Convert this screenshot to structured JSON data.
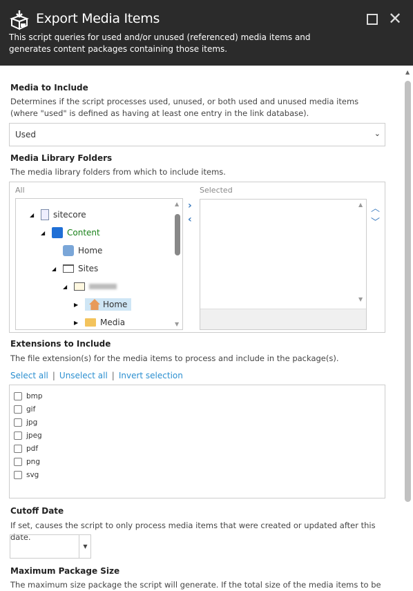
{
  "dialog": {
    "title": "Export Media Items",
    "description": "This script queries for used and/or unused (referenced) media items and generates content packages containing those items."
  },
  "media_include": {
    "label": "Media to Include",
    "description": "Determines if the script processes used, unused, or both used and unused media items (where \"used\" is defined as having at least one entry in the link database).",
    "value": "Used"
  },
  "folders": {
    "label": "Media Library Folders",
    "description": "The media library folders from which to include items.",
    "all_label": "All",
    "selected_label": "Selected",
    "tree": [
      "sitecore",
      "Content",
      "Home",
      "Sites",
      "",
      "Home",
      "Media"
    ]
  },
  "extensions": {
    "label": "Extensions to Include",
    "description": "The file extension(s) for the media items to process and include in the package(s).",
    "select_all": "Select all",
    "unselect_all": "Unselect all",
    "invert": "Invert selection",
    "sep": "|",
    "items": [
      "bmp",
      "gif",
      "jpg",
      "jpeg",
      "pdf",
      "png",
      "svg"
    ]
  },
  "cutoff": {
    "label": "Cutoff Date",
    "description": "If set, causes the script to only process media items that were created or updated after this date.",
    "value": ""
  },
  "max_size": {
    "label": "Maximum Package Size",
    "description": "The maximum size package the script will generate. If the total size of the media items to be"
  }
}
